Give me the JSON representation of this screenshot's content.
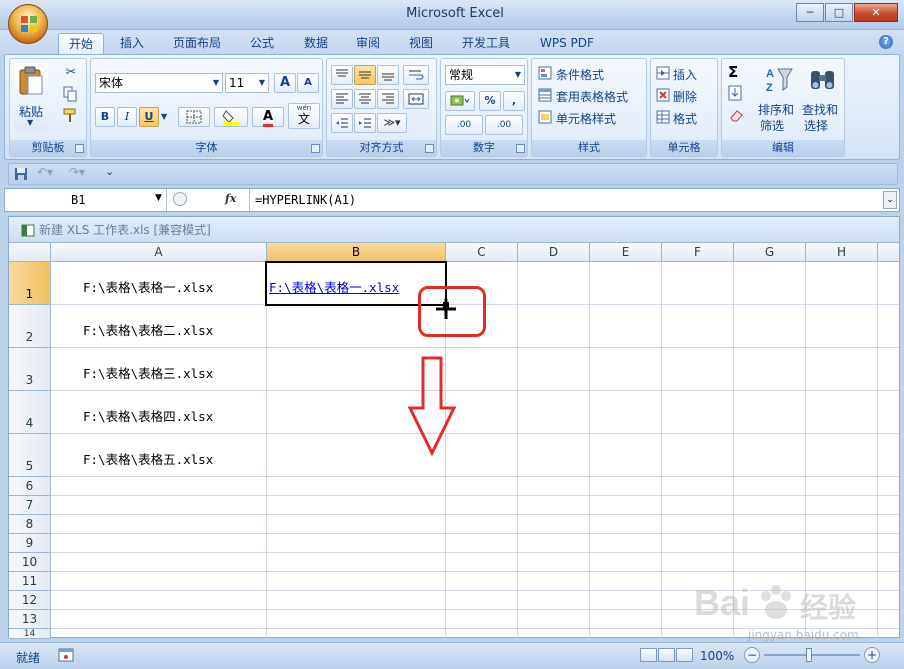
{
  "window": {
    "title": "Microsoft Excel",
    "controls": [
      "─",
      "□",
      "✕"
    ]
  },
  "tabs": [
    "开始",
    "插入",
    "页面布局",
    "公式",
    "数据",
    "审阅",
    "视图",
    "开发工具",
    "WPS PDF"
  ],
  "active_tab": "开始",
  "ribbon": {
    "clipboard": {
      "paste_label": "粘贴",
      "group_title": "剪贴板"
    },
    "font": {
      "font_name": "宋体",
      "font_size": "11",
      "group_title": "字体",
      "bold": "B",
      "italic": "I",
      "underline": "U",
      "grow": "A",
      "shrink": "A",
      "font_color": "A",
      "wen": "wén",
      "wen_char": "文"
    },
    "alignment": {
      "group_title": "对齐方式"
    },
    "number": {
      "format": "常规",
      "percent": "%",
      "comma": ",",
      "inc_decimal": ".00",
      "dec_decimal": ".00",
      "group_title": "数字"
    },
    "styles": {
      "conditional": "条件格式",
      "table_format": "套用表格格式",
      "cell_styles": "单元格样式",
      "group_title": "样式"
    },
    "cells": {
      "insert": "插入",
      "delete": "删除",
      "format": "格式",
      "group_title": "单元格"
    },
    "editing": {
      "sum": "Σ",
      "sort_filter_line1": "排序和",
      "sort_filter_line2": "筛选",
      "find_select_line1": "查找和",
      "find_select_line2": "选择",
      "group_title": "编辑"
    }
  },
  "formula_bar": {
    "name_box": "B1",
    "fx": "fx",
    "formula": "=HYPERLINK(A1)"
  },
  "workbook": {
    "title": "新建 XLS 工作表.xls  [兼容模式]"
  },
  "columns": [
    "A",
    "B",
    "C",
    "D",
    "E",
    "F",
    "G",
    "H"
  ],
  "rows": [
    "1",
    "2",
    "3",
    "4",
    "5",
    "6",
    "7",
    "8",
    "9",
    "10",
    "11",
    "12",
    "13",
    "14"
  ],
  "cells": {
    "A1": "F:\\表格\\表格一.xlsx",
    "A2": "F:\\表格\\表格二.xlsx",
    "A3": "F:\\表格\\表格三.xlsx",
    "A4": "F:\\表格\\表格四.xlsx",
    "A5": "F:\\表格\\表格五.xlsx",
    "B1": "F:\\表格\\表格一.xlsx"
  },
  "selected_cell": "B1",
  "status": {
    "text": "就绪",
    "zoom": "100%",
    "zoom_minus": "−",
    "zoom_plus": "+"
  },
  "watermark": {
    "brand": "Bai",
    "brand_cn": "经验",
    "sub": "jingyan.baidu.com"
  },
  "colors": {
    "accent": "#15428b",
    "annotation": "#e32b2b",
    "hyperlink": "#0000ee",
    "selected_header": "#f1c15f"
  }
}
